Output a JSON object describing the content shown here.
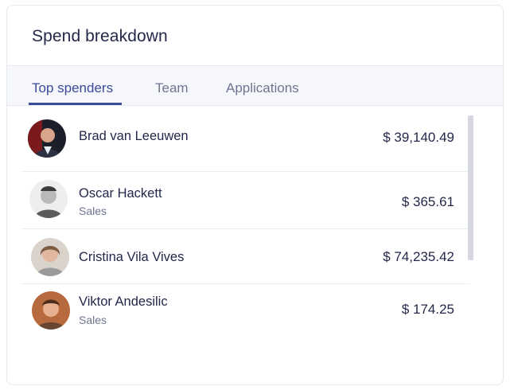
{
  "card": {
    "title": "Spend breakdown"
  },
  "tabs": [
    {
      "label": "Top spenders",
      "active": true
    },
    {
      "label": "Team",
      "active": false
    },
    {
      "label": "Applications",
      "active": false
    }
  ],
  "spenders": [
    {
      "name": "Brad van Leeuwen",
      "department": "",
      "amount": "$ 39,140.49"
    },
    {
      "name": "Oscar Hackett",
      "department": "Sales",
      "amount": "$ 365.61"
    },
    {
      "name": "Cristina Vila Vives",
      "department": "",
      "amount": "$ 74,235.42"
    },
    {
      "name": "Viktor Andesilic",
      "department": "Sales",
      "amount": "$ 174.25"
    }
  ],
  "colors": {
    "accent": "#3b4a9a",
    "text": "#23284a",
    "muted": "#6e7590"
  }
}
